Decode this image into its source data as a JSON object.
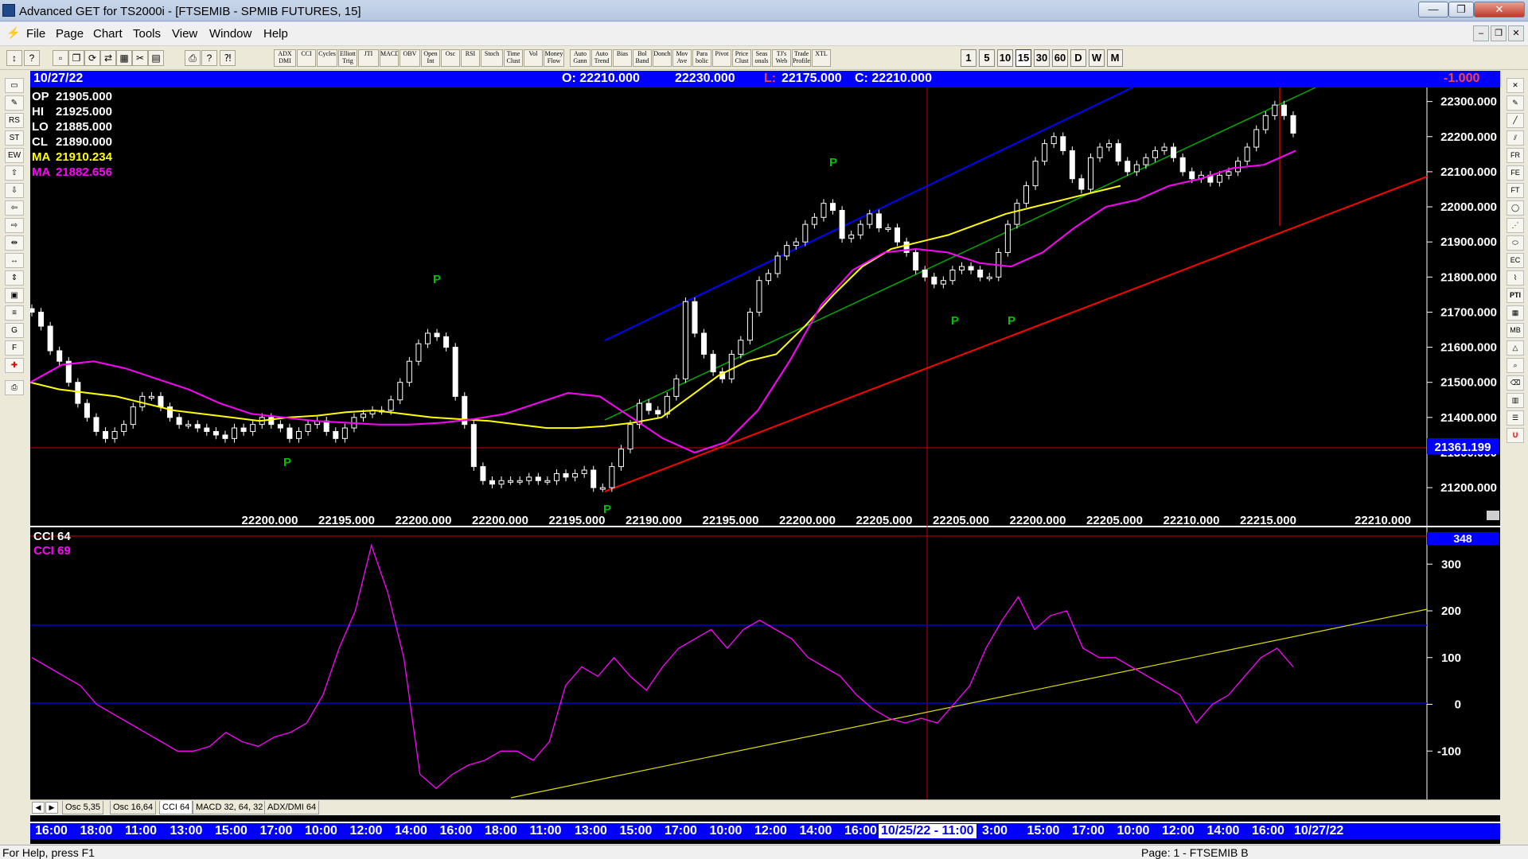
{
  "window": {
    "title": "Advanced GET for TS2000i - [FTSEMIB - SPMIB FUTURES, 15]",
    "minimize": "—",
    "maximize": "❐",
    "close": "✕"
  },
  "menu": {
    "items": [
      "File",
      "Page",
      "Chart",
      "Tools",
      "View",
      "Window",
      "Help"
    ]
  },
  "toolbar": {
    "studies": [
      "ADX DMI",
      "CCI",
      "Cycles",
      "Elliott Trig",
      "JTI",
      "MACD",
      "OBV",
      "Open Int",
      "Osc",
      "RSI",
      "Stoch",
      "Time Clust",
      "Vol",
      "Money Flow",
      "Auto Gann",
      "Auto Trend",
      "Bias",
      "Bol Band",
      "Donch",
      "Mov Ave",
      "Para bolic",
      "Pivot",
      "Price Clust",
      "Seas onals",
      "TJ's Web",
      "Trade Profile",
      "XTL"
    ],
    "timeframes": [
      "1",
      "5",
      "10",
      "15",
      "30",
      "60",
      "D",
      "W",
      "M"
    ]
  },
  "header": {
    "date": "10/27/22",
    "open": "O: 22210.000",
    "high": "22230.000",
    "low_label": "L:",
    "low": "22175.000",
    "close": "C: 22210.000",
    "change": "-1.000"
  },
  "price_info": {
    "rows": [
      {
        "label": "OP",
        "value": "21905.000",
        "color": "#ffffff"
      },
      {
        "label": "HI",
        "value": "21925.000",
        "color": "#ffffff"
      },
      {
        "label": "LO",
        "value": "21885.000",
        "color": "#ffffff"
      },
      {
        "label": "CL",
        "value": "21890.000",
        "color": "#ffffff"
      },
      {
        "label": "MA",
        "value": "21910.234",
        "color": "#ffff00"
      },
      {
        "label": "MA",
        "value": "21882.656",
        "color": "#ff00ff"
      }
    ]
  },
  "price_axis": {
    "ticks": [
      "22300.000",
      "22200.000",
      "22100.000",
      "22000.000",
      "21900.000",
      "21800.000",
      "21700.000",
      "21600.000",
      "21500.000",
      "21400.000",
      "21300.000",
      "21200.000"
    ],
    "cursor_value": "21361.199"
  },
  "close_labels": {
    "items": [
      "22200.000",
      "22195.000",
      "22200.000",
      "22200.000",
      "22195.000",
      "22190.000",
      "22195.000",
      "22200.000",
      "22205.000",
      "22205.000",
      "22200.000",
      "22205.000",
      "22210.000",
      "22215.000"
    ],
    "last": "22210.000"
  },
  "pivots": {
    "labels": [
      "P",
      "P",
      "P",
      "P",
      "P",
      "P",
      "P"
    ]
  },
  "osc": {
    "legend1": "CCI 64",
    "legend2": "CCI  69",
    "ticks": [
      "300",
      "200",
      "100",
      "0",
      "-100"
    ],
    "value_badge": "348"
  },
  "tabs": [
    "Osc 5,35",
    "Osc 16,64",
    "CCI 64",
    "MACD 32, 64, 32",
    "ADX/DMI 64"
  ],
  "time_axis": {
    "labels": [
      "16:00",
      "18:00",
      "11:00",
      "13:00",
      "15:00",
      "17:00",
      "10:00",
      "12:00",
      "14:00",
      "16:00",
      "18:00",
      "11:00",
      "13:00",
      "15:00",
      "17:00",
      "10:00",
      "12:00",
      "14:00",
      "16:00"
    ],
    "cursor": "10/25/22 - 11:00",
    "after": [
      "3:00",
      "15:00",
      "17:00",
      "10:00",
      "12:00",
      "14:00",
      "16:00"
    ],
    "last": "10/27/22"
  },
  "status": {
    "left": "For Help, press F1",
    "right": "Page: 1 - FTSEMIB B"
  },
  "colors": {
    "bg": "#000000",
    "accent": "#0000ff",
    "ma_fast": "#ffff00",
    "ma_slow": "#ff00ff",
    "support": "#ff0000",
    "upper": "#0000ff",
    "mid": "#00a000",
    "pivot": "#00c000"
  },
  "chart_data": [
    {
      "type": "candlestick",
      "title": "FTSEMIB - SPMIB FUTURES, 15",
      "ylim": [
        21130,
        22340
      ],
      "y_ticks": [
        21200,
        21300,
        21400,
        21500,
        21600,
        21700,
        21800,
        21900,
        22000,
        22100,
        22200,
        22300
      ],
      "bars": [
        21700,
        21660,
        21590,
        21560,
        21500,
        21440,
        21400,
        21360,
        21340,
        21360,
        21380,
        21430,
        21460,
        21460,
        21430,
        21400,
        21380,
        21380,
        21370,
        21360,
        21350,
        21340,
        21370,
        21360,
        21380,
        21400,
        21380,
        21370,
        21340,
        21360,
        21380,
        21390,
        21360,
        21340,
        21370,
        21400,
        21410,
        21420,
        21420,
        21450,
        21500,
        21560,
        21610,
        21640,
        21630,
        21600,
        21460,
        21380,
        21260,
        21220,
        21210,
        21220,
        21220,
        21220,
        21230,
        21220,
        21220,
        21240,
        21230,
        21240,
        21250,
        21200,
        21200,
        21260,
        21310,
        21380,
        21440,
        21420,
        21410,
        21460,
        21510,
        21730,
        21640,
        21580,
        21530,
        21510,
        21580,
        21620,
        21700,
        21790,
        21810,
        21860,
        21890,
        21900,
        21950,
        21970,
        22010,
        21990,
        21910,
        21920,
        21950,
        21980,
        21940,
        21940,
        21900,
        21870,
        21820,
        21800,
        21780,
        21790,
        21820,
        21830,
        21820,
        21800,
        21800,
        21870,
        21950,
        22010,
        22060,
        22130,
        22180,
        22200,
        22160,
        22080,
        22050,
        22140,
        22170,
        22180,
        22130,
        22100,
        22120,
        22140,
        22160,
        22170,
        22140,
        22100,
        22080,
        22090,
        22070,
        22090,
        22100,
        22130,
        22170,
        22220,
        22260,
        22290,
        22260,
        22210
      ],
      "ma_fast": [
        21500,
        21480,
        21470,
        21460,
        21440,
        21420,
        21410,
        21400,
        21390,
        21400,
        21405,
        21415,
        21420,
        21410,
        21400,
        21395,
        21390,
        21380,
        21370,
        21370,
        21375,
        21385,
        21400,
        21460,
        21520,
        21560,
        21580,
        21660,
        21750,
        21830,
        21880,
        21900,
        21920,
        21950,
        21980,
        22000,
        22020,
        22040,
        22060
      ],
      "ma_slow": [
        21500,
        21550,
        21560,
        21540,
        21510,
        21480,
        21440,
        21410,
        21400,
        21390,
        21385,
        21380,
        21380,
        21385,
        21395,
        21410,
        21440,
        21470,
        21460,
        21400,
        21340,
        21300,
        21330,
        21420,
        21560,
        21720,
        21820,
        21870,
        21880,
        21870,
        21840,
        21830,
        21870,
        21940,
        22000,
        22020,
        22060,
        22080,
        22110,
        22120,
        22160
      ],
      "pivot_labels": [
        "P",
        "P",
        "P",
        "P",
        "P",
        "P",
        "P"
      ]
    },
    {
      "type": "line",
      "title": "CCI 64",
      "ylim": [
        -200,
        360
      ],
      "y_ticks": [
        -100,
        0,
        100,
        200,
        300
      ],
      "values": [
        100,
        80,
        60,
        40,
        0,
        -20,
        -40,
        -60,
        -80,
        -100,
        -100,
        -90,
        -60,
        -80,
        -90,
        -70,
        -60,
        -40,
        20,
        120,
        200,
        340,
        240,
        100,
        -150,
        -180,
        -150,
        -130,
        -120,
        -100,
        -100,
        -120,
        -80,
        40,
        80,
        60,
        100,
        60,
        30,
        80,
        120,
        140,
        160,
        120,
        160,
        180,
        160,
        140,
        100,
        80,
        60,
        20,
        -10,
        -30,
        -40,
        -30,
        -40,
        0,
        40,
        120,
        180,
        230,
        160,
        190,
        200,
        120,
        100,
        100,
        80,
        60,
        40,
        20,
        -40,
        0,
        20,
        60,
        100,
        120,
        80
      ]
    }
  ]
}
